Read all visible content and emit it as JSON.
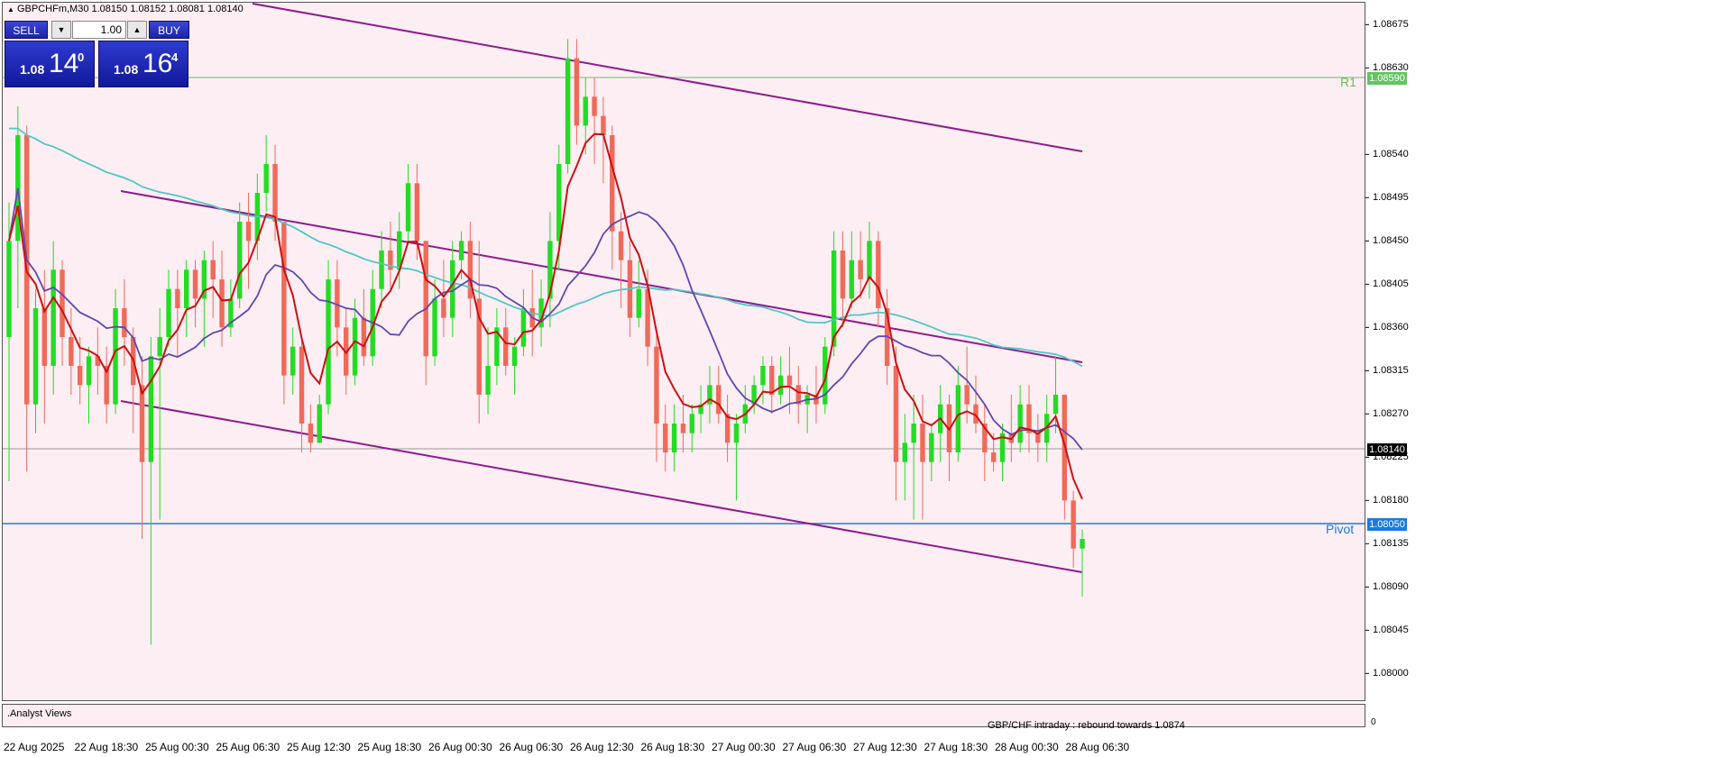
{
  "symbol_info": "GBPCHFm,M30  1.08150 1.08152 1.08081 1.08140",
  "trade_panel": {
    "sell_label": "SELL",
    "buy_label": "BUY",
    "lot": "1.00",
    "sell_quote": {
      "prefix": "1.08",
      "big": "14",
      "sup": "0"
    },
    "buy_quote": {
      "prefix": "1.08",
      "big": "16",
      "sup": "4"
    },
    "decrease_icon": "arrow-down",
    "increase_icon": "arrow-up"
  },
  "levels": {
    "r1_label": "R1",
    "r1_price": "1.08590",
    "pivot_label": "Pivot",
    "pivot_price": "1.08050",
    "current_price": "1.08140"
  },
  "colors": {
    "plot_bg": "#fdeef3",
    "bull": "#22dd22",
    "bear": "#f06a5a",
    "ema_fast": "#cc1010",
    "ma_mid": "#5e48b0",
    "ma_slow": "#4fc8c4",
    "channel": "#8e1a8e",
    "r1": "#62c462",
    "pivot": "#1a7ae0"
  },
  "indicator": {
    "label": ".Analyst Views",
    "text": "GBP/CHF intraday :  rebound towards 1.0874",
    "scale": "0"
  },
  "chart_data": {
    "type": "candlestick",
    "title": "GBPCHFm,M30",
    "y_ticks": [
      "1.08675",
      "1.08630",
      "1.08540",
      "1.08495",
      "1.08450",
      "1.08405",
      "1.08360",
      "1.08315",
      "1.08270",
      "1.08225",
      "1.08180",
      "1.08135",
      "1.08090",
      "1.08045",
      "1.08000"
    ],
    "ylim": [
      1.07975,
      1.08695
    ],
    "x_ticks": [
      "22 Aug 2025",
      "22 Aug 18:30",
      "25 Aug 00:30",
      "25 Aug 06:30",
      "25 Aug 12:30",
      "25 Aug 18:30",
      "26 Aug 00:30",
      "26 Aug 06:30",
      "26 Aug 12:30",
      "26 Aug 18:30",
      "27 Aug 00:30",
      "27 Aug 06:30",
      "27 Aug 12:30",
      "27 Aug 18:30",
      "28 Aug 00:30",
      "28 Aug 06:30"
    ],
    "candles_ohlc": [
      [
        1.0835,
        1.0849,
        1.082,
        1.0845
      ],
      [
        1.0845,
        1.0859,
        1.0838,
        1.0856
      ],
      [
        1.0856,
        1.0857,
        1.0821,
        1.0828
      ],
      [
        1.0828,
        1.084,
        1.0825,
        1.0838
      ],
      [
        1.0838,
        1.0842,
        1.0826,
        1.0832
      ],
      [
        1.0832,
        1.0845,
        1.0829,
        1.0842
      ],
      [
        1.0842,
        1.0843,
        1.0832,
        1.0835
      ],
      [
        1.0835,
        1.0838,
        1.0829,
        1.0832
      ],
      [
        1.0832,
        1.0835,
        1.0828,
        1.083
      ],
      [
        1.083,
        1.0834,
        1.0826,
        1.0833
      ],
      [
        1.0833,
        1.0836,
        1.0829,
        1.0832
      ],
      [
        1.0832,
        1.0834,
        1.0826,
        1.0828
      ],
      [
        1.0828,
        1.084,
        1.0827,
        1.0838
      ],
      [
        1.0838,
        1.0841,
        1.0832,
        1.0835
      ],
      [
        1.0835,
        1.0836,
        1.0825,
        1.083
      ],
      [
        1.083,
        1.0833,
        1.0814,
        1.0822
      ],
      [
        1.0822,
        1.0835,
        1.0803,
        1.0833
      ],
      [
        1.0833,
        1.0838,
        1.0816,
        1.0835
      ],
      [
        1.0835,
        1.0842,
        1.0834,
        1.084
      ],
      [
        1.084,
        1.0842,
        1.0833,
        1.0838
      ],
      [
        1.0838,
        1.0843,
        1.0835,
        1.0842
      ],
      [
        1.0842,
        1.0843,
        1.0836,
        1.0839
      ],
      [
        1.0839,
        1.0844,
        1.0834,
        1.0843
      ],
      [
        1.0843,
        1.0845,
        1.0837,
        1.0841
      ],
      [
        1.0841,
        1.0844,
        1.0834,
        1.0836
      ],
      [
        1.0836,
        1.0841,
        1.0835,
        1.0839
      ],
      [
        1.0839,
        1.0849,
        1.0838,
        1.0847
      ],
      [
        1.0847,
        1.085,
        1.084,
        1.0845
      ],
      [
        1.0845,
        1.0852,
        1.0843,
        1.085
      ],
      [
        1.085,
        1.0856,
        1.0848,
        1.0853
      ],
      [
        1.0853,
        1.0855,
        1.0845,
        1.0847
      ],
      [
        1.0847,
        1.0847,
        1.0828,
        1.0831
      ],
      [
        1.0831,
        1.0836,
        1.0829,
        1.0834
      ],
      [
        1.0834,
        1.0835,
        1.0823,
        1.0826
      ],
      [
        1.0826,
        1.0828,
        1.0823,
        1.0824
      ],
      [
        1.0824,
        1.0829,
        1.0824,
        1.0828
      ],
      [
        1.0828,
        1.0843,
        1.0827,
        1.0841
      ],
      [
        1.0841,
        1.0843,
        1.0833,
        1.0836
      ],
      [
        1.0836,
        1.0838,
        1.0829,
        1.0831
      ],
      [
        1.0831,
        1.0839,
        1.083,
        1.0837
      ],
      [
        1.0837,
        1.084,
        1.0832,
        1.0833
      ],
      [
        1.0833,
        1.0842,
        1.0832,
        1.084
      ],
      [
        1.084,
        1.0846,
        1.0838,
        1.0844
      ],
      [
        1.0844,
        1.0847,
        1.084,
        1.0842
      ],
      [
        1.0842,
        1.0848,
        1.084,
        1.0846
      ],
      [
        1.0846,
        1.0853,
        1.0845,
        1.0851
      ],
      [
        1.0851,
        1.0853,
        1.0843,
        1.0845
      ],
      [
        1.0845,
        1.0845,
        1.083,
        1.0833
      ],
      [
        1.0833,
        1.0841,
        1.0832,
        1.0839
      ],
      [
        1.0839,
        1.0843,
        1.0835,
        1.0837
      ],
      [
        1.0837,
        1.0845,
        1.0835,
        1.0843
      ],
      [
        1.0843,
        1.0846,
        1.0841,
        1.0845
      ],
      [
        1.0845,
        1.0847,
        1.0837,
        1.0839
      ],
      [
        1.0839,
        1.0845,
        1.0826,
        1.0829
      ],
      [
        1.0829,
        1.0836,
        1.0827,
        1.0832
      ],
      [
        1.0832,
        1.0838,
        1.083,
        1.0836
      ],
      [
        1.0836,
        1.0838,
        1.0831,
        1.0832
      ],
      [
        1.0832,
        1.0835,
        1.0829,
        1.0834
      ],
      [
        1.0834,
        1.084,
        1.0833,
        1.0838
      ],
      [
        1.0838,
        1.0842,
        1.0833,
        1.0836
      ],
      [
        1.0836,
        1.0841,
        1.0834,
        1.0839
      ],
      [
        1.0839,
        1.0848,
        1.0836,
        1.0845
      ],
      [
        1.0845,
        1.0855,
        1.0842,
        1.0853
      ],
      [
        1.0853,
        1.0866,
        1.0852,
        1.0864
      ],
      [
        1.0864,
        1.0866,
        1.0855,
        1.0857
      ],
      [
        1.0857,
        1.0862,
        1.0854,
        1.086
      ],
      [
        1.086,
        1.0862,
        1.0853,
        1.0858
      ],
      [
        1.0858,
        1.086,
        1.0851,
        1.0856
      ],
      [
        1.0856,
        1.0857,
        1.0842,
        1.0846
      ],
      [
        1.0846,
        1.0848,
        1.0838,
        1.0843
      ],
      [
        1.0843,
        1.0845,
        1.0835,
        1.0837
      ],
      [
        1.0837,
        1.0843,
        1.0836,
        1.084
      ],
      [
        1.084,
        1.0842,
        1.0832,
        1.0834
      ],
      [
        1.0834,
        1.0836,
        1.0822,
        1.0826
      ],
      [
        1.0826,
        1.0828,
        1.0821,
        1.0823
      ],
      [
        1.0823,
        1.0828,
        1.0821,
        1.0826
      ],
      [
        1.0826,
        1.0829,
        1.0823,
        1.0825
      ],
      [
        1.0825,
        1.0828,
        1.0823,
        1.0827
      ],
      [
        1.0827,
        1.083,
        1.0825,
        1.0828
      ],
      [
        1.0828,
        1.0832,
        1.0826,
        1.083
      ],
      [
        1.083,
        1.0832,
        1.0826,
        1.0827
      ],
      [
        1.0827,
        1.0829,
        1.0822,
        1.0824
      ],
      [
        1.0824,
        1.0827,
        1.0818,
        1.0826
      ],
      [
        1.0826,
        1.083,
        1.0825,
        1.0828
      ],
      [
        1.0828,
        1.0831,
        1.0827,
        1.083
      ],
      [
        1.083,
        1.0833,
        1.0828,
        1.0832
      ],
      [
        1.0832,
        1.0833,
        1.0827,
        1.0829
      ],
      [
        1.0829,
        1.0833,
        1.0828,
        1.0831
      ],
      [
        1.0831,
        1.0834,
        1.0827,
        1.083
      ],
      [
        1.083,
        1.0832,
        1.0826,
        1.0828
      ],
      [
        1.0828,
        1.083,
        1.0825,
        1.0829
      ],
      [
        1.0829,
        1.0832,
        1.0826,
        1.0828
      ],
      [
        1.0828,
        1.0835,
        1.0827,
        1.0834
      ],
      [
        1.0834,
        1.0846,
        1.0833,
        1.0844
      ],
      [
        1.0844,
        1.0846,
        1.0836,
        1.0839
      ],
      [
        1.0839,
        1.0846,
        1.0838,
        1.0843
      ],
      [
        1.0843,
        1.0846,
        1.0839,
        1.0841
      ],
      [
        1.0841,
        1.0847,
        1.0839,
        1.0845
      ],
      [
        1.0845,
        1.0846,
        1.0836,
        1.0838
      ],
      [
        1.0838,
        1.084,
        1.083,
        1.0832
      ],
      [
        1.0832,
        1.0834,
        1.0818,
        1.0822
      ],
      [
        1.0822,
        1.0827,
        1.0818,
        1.0824
      ],
      [
        1.0824,
        1.0829,
        1.0816,
        1.0826
      ],
      [
        1.0826,
        1.0829,
        1.0816,
        1.0822
      ],
      [
        1.0822,
        1.0826,
        1.082,
        1.0825
      ],
      [
        1.0825,
        1.083,
        1.0822,
        1.0828
      ],
      [
        1.0828,
        1.0829,
        1.082,
        1.0823
      ],
      [
        1.0823,
        1.0832,
        1.0822,
        1.083
      ],
      [
        1.083,
        1.0834,
        1.0826,
        1.0828
      ],
      [
        1.0828,
        1.0831,
        1.0825,
        1.0826
      ],
      [
        1.0826,
        1.0828,
        1.082,
        1.0823
      ],
      [
        1.0823,
        1.0825,
        1.0821,
        1.0822
      ],
      [
        1.0822,
        1.0826,
        1.082,
        1.0825
      ],
      [
        1.0825,
        1.0829,
        1.0822,
        1.0824
      ],
      [
        1.0824,
        1.083,
        1.0823,
        1.0828
      ],
      [
        1.0828,
        1.083,
        1.0823,
        1.0825
      ],
      [
        1.0825,
        1.0827,
        1.0822,
        1.0824
      ],
      [
        1.0824,
        1.0829,
        1.0822,
        1.0827
      ],
      [
        1.0827,
        1.0833,
        1.0825,
        1.0829
      ],
      [
        1.0829,
        1.0829,
        1.0816,
        1.0818
      ],
      [
        1.0818,
        1.0819,
        1.0811,
        1.0813
      ],
      [
        1.0813,
        1.0815,
        1.0808,
        1.0814
      ]
    ]
  }
}
